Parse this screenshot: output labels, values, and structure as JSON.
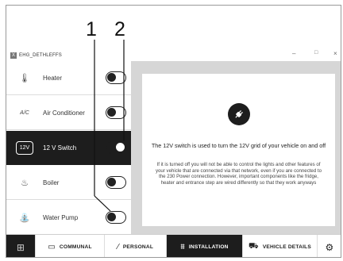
{
  "callouts": {
    "first": "1",
    "second": "2"
  },
  "window": {
    "title": "EHG_DETHLEFFS",
    "icon_letter": "X",
    "minimize": "–",
    "maximize": "□",
    "close": "×"
  },
  "sidebar": {
    "items": [
      {
        "label": "Heater",
        "icon": "thermometer-icon",
        "glyph": "🌡",
        "toggle": "off",
        "active": false
      },
      {
        "label": "Air Conditioner",
        "icon": "ac-icon",
        "glyph": "A/C",
        "toggle": "off",
        "active": false
      },
      {
        "label": "12 V Switch",
        "icon": "12v-icon",
        "glyph": "12V",
        "toggle": "on",
        "active": true
      },
      {
        "label": "Boiler",
        "icon": "flame-icon",
        "glyph": "♨",
        "toggle": "off",
        "active": false
      },
      {
        "label": "Water Pump",
        "icon": "faucet-icon",
        "glyph": "⛲",
        "toggle": "off",
        "active": false
      }
    ]
  },
  "info": {
    "title": "The 12V switch is used to turn the 12V grid of your vehicle on and off",
    "body": "If it is turned off you will not be able to control the lights and other features of your vehicle that are connected via that network, even if you are connected to the 230 Power connection. However, important components like the fridge, heater and entrance step are wired differently so that they work anyways",
    "icon": "plug-icon"
  },
  "tabs": [
    {
      "label": "",
      "icon": "grid-icon",
      "glyph": "⊞"
    },
    {
      "label": "COMMUNAL",
      "icon": "communal-icon",
      "glyph": "▭"
    },
    {
      "label": "PERSONAL",
      "icon": "personal-icon",
      "glyph": "⁄"
    },
    {
      "label": "INSTALLATION",
      "icon": "installation-icon",
      "glyph": "⩩",
      "active": true
    },
    {
      "label": "VEHICLE DETAILS",
      "icon": "vehicle-icon",
      "glyph": "⛟"
    },
    {
      "label": "",
      "icon": "gear-icon",
      "glyph": "⚙"
    }
  ]
}
